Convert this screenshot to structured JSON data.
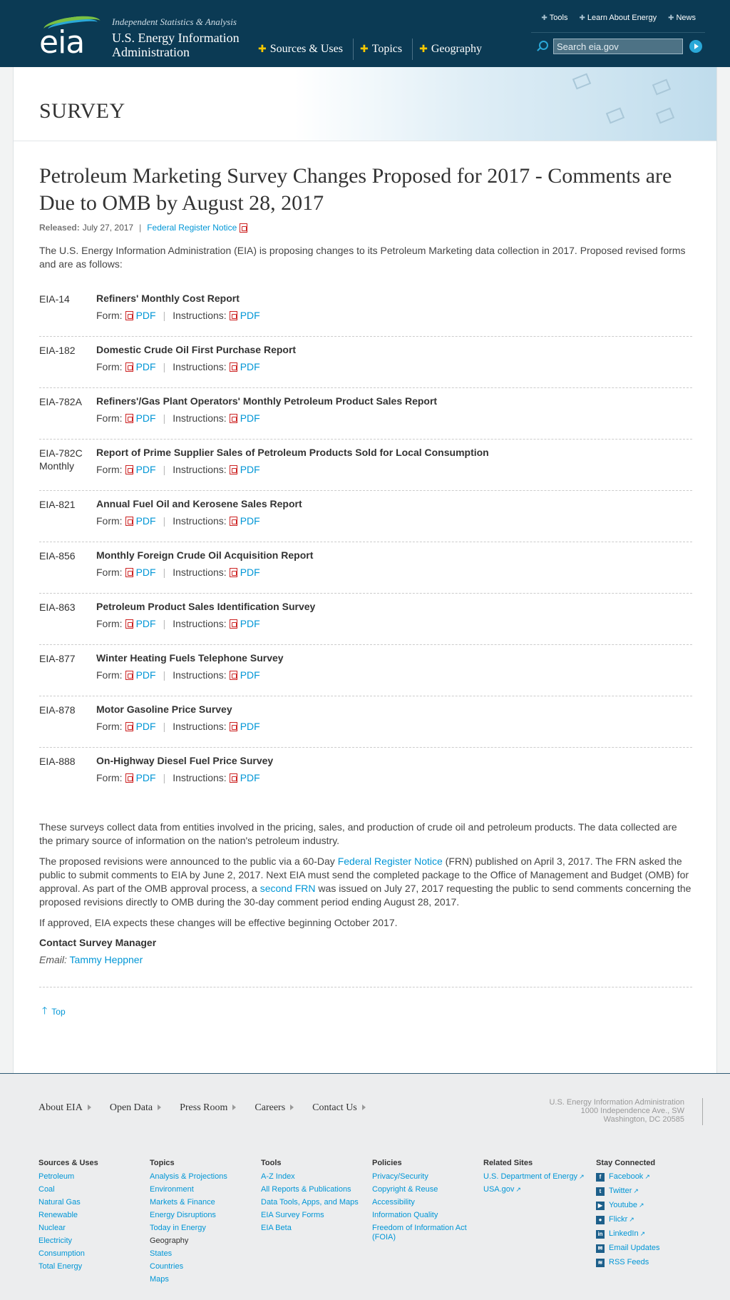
{
  "header": {
    "logo_text": "eia",
    "tagline": "Independent Statistics & Analysis",
    "org_name_line1": "U.S. Energy Information",
    "org_name_line2": "Administration",
    "nav": [
      "Sources & Uses",
      "Topics",
      "Geography"
    ],
    "util_nav": [
      "Tools",
      "Learn About Energy",
      "News"
    ],
    "search_placeholder": "Search eia.gov"
  },
  "banner": {
    "title": "SURVEY"
  },
  "article": {
    "title": "Petroleum Marketing Survey Changes Proposed for 2017 - Comments are Due to OMB by August 28, 2017",
    "released_label": "Released:",
    "released_date": "July 27, 2017",
    "federal_register_link": "Federal Register Notice",
    "intro": "The U.S. Energy Information Administration (EIA) is proposing changes to its Petroleum Marketing data collection in 2017. Proposed revised forms and are as follows:",
    "form_label": "Form:",
    "instructions_label": "Instructions:",
    "pdf_label": "PDF",
    "forms": [
      {
        "code": "EIA-14",
        "code2": "",
        "name": "Refiners' Monthly Cost Report"
      },
      {
        "code": "EIA-182",
        "code2": "",
        "name": "Domestic Crude Oil First Purchase Report"
      },
      {
        "code": "EIA-782A",
        "code2": "",
        "name": "Refiners'/Gas Plant Operators' Monthly Petroleum Product Sales Report"
      },
      {
        "code": "EIA-782C",
        "code2": "Monthly",
        "name": "Report of Prime Supplier Sales of Petroleum Products Sold for Local Consumption"
      },
      {
        "code": "EIA-821",
        "code2": "",
        "name": "Annual Fuel Oil and Kerosene Sales Report"
      },
      {
        "code": "EIA-856",
        "code2": "",
        "name": "Monthly Foreign Crude Oil Acquisition Report"
      },
      {
        "code": "EIA-863",
        "code2": "",
        "name": "Petroleum Product Sales Identification Survey"
      },
      {
        "code": "EIA-877",
        "code2": "",
        "name": "Winter Heating Fuels Telephone Survey"
      },
      {
        "code": "EIA-878",
        "code2": "",
        "name": "Motor Gasoline Price Survey"
      },
      {
        "code": "EIA-888",
        "code2": "",
        "name": "On-Highway Diesel Fuel Price Survey"
      }
    ],
    "para1": "These surveys collect data from entities involved in the pricing, sales, and production of crude oil and petroleum products. The data collected are the primary source of information on the nation's petroleum industry.",
    "para2_a": "The proposed revisions were announced to the public via a 60-Day ",
    "para2_link1": "Federal Register Notice",
    "para2_b": " (FRN) published on April 3, 2017. The FRN asked the public to submit comments to EIA by June 2, 2017. Next EIA must send the completed package to the Office of Management and Budget (OMB) for approval. As part of the OMB approval process, a ",
    "para2_link2": "second FRN",
    "para2_c": " was issued on July 27, 2017 requesting the public to send comments concerning the proposed revisions directly to OMB during the 30-day comment period ending August 28, 2017.",
    "para3": "If approved, EIA expects these changes will be effective beginning October 2017.",
    "contact_heading": "Contact Survey Manager",
    "email_label": "Email:",
    "email_name": "Tammy Heppner",
    "top_label": "Top"
  },
  "footer": {
    "nav": [
      "About EIA",
      "Open Data",
      "Press Room",
      "Careers",
      "Contact Us"
    ],
    "address": [
      "U.S. Energy Information Administration",
      "1000 Independence Ave., SW",
      "Washington, DC 20585"
    ],
    "columns": [
      {
        "heading": "Sources & Uses",
        "links": [
          "Petroleum",
          "Coal",
          "Natural Gas",
          "Renewable",
          "Nuclear",
          "Electricity",
          "Consumption",
          "Total Energy"
        ]
      },
      {
        "heading": "Topics",
        "links": [
          "Analysis & Projections",
          "Environment",
          "Markets & Finance",
          "Energy Disruptions",
          "Today in Energy"
        ],
        "subheading": "Geography",
        "sublinks": [
          "States",
          "Countries",
          "Maps"
        ]
      },
      {
        "heading": "Tools",
        "links": [
          "A-Z Index",
          "All Reports & Publications",
          "Data Tools, Apps, and Maps",
          "EIA Survey Forms",
          "EIA Beta"
        ]
      },
      {
        "heading": "Policies",
        "links": [
          "Privacy/Security",
          "Copyright & Reuse",
          "Accessibility",
          "Information Quality",
          "Freedom of Information Act (FOIA)"
        ]
      },
      {
        "heading": "Related Sites",
        "links": [
          "U.S. Department of Energy",
          "USA.gov"
        ]
      },
      {
        "heading": "Stay Connected",
        "links": [
          "Facebook",
          "Twitter",
          "Youtube",
          "Flickr",
          "LinkedIn",
          "Email Updates",
          "RSS Feeds"
        ]
      }
    ]
  },
  "colors": {
    "header_bg": "#0b3a54",
    "link": "#0096d6",
    "accent_plus": "#f5c800"
  }
}
